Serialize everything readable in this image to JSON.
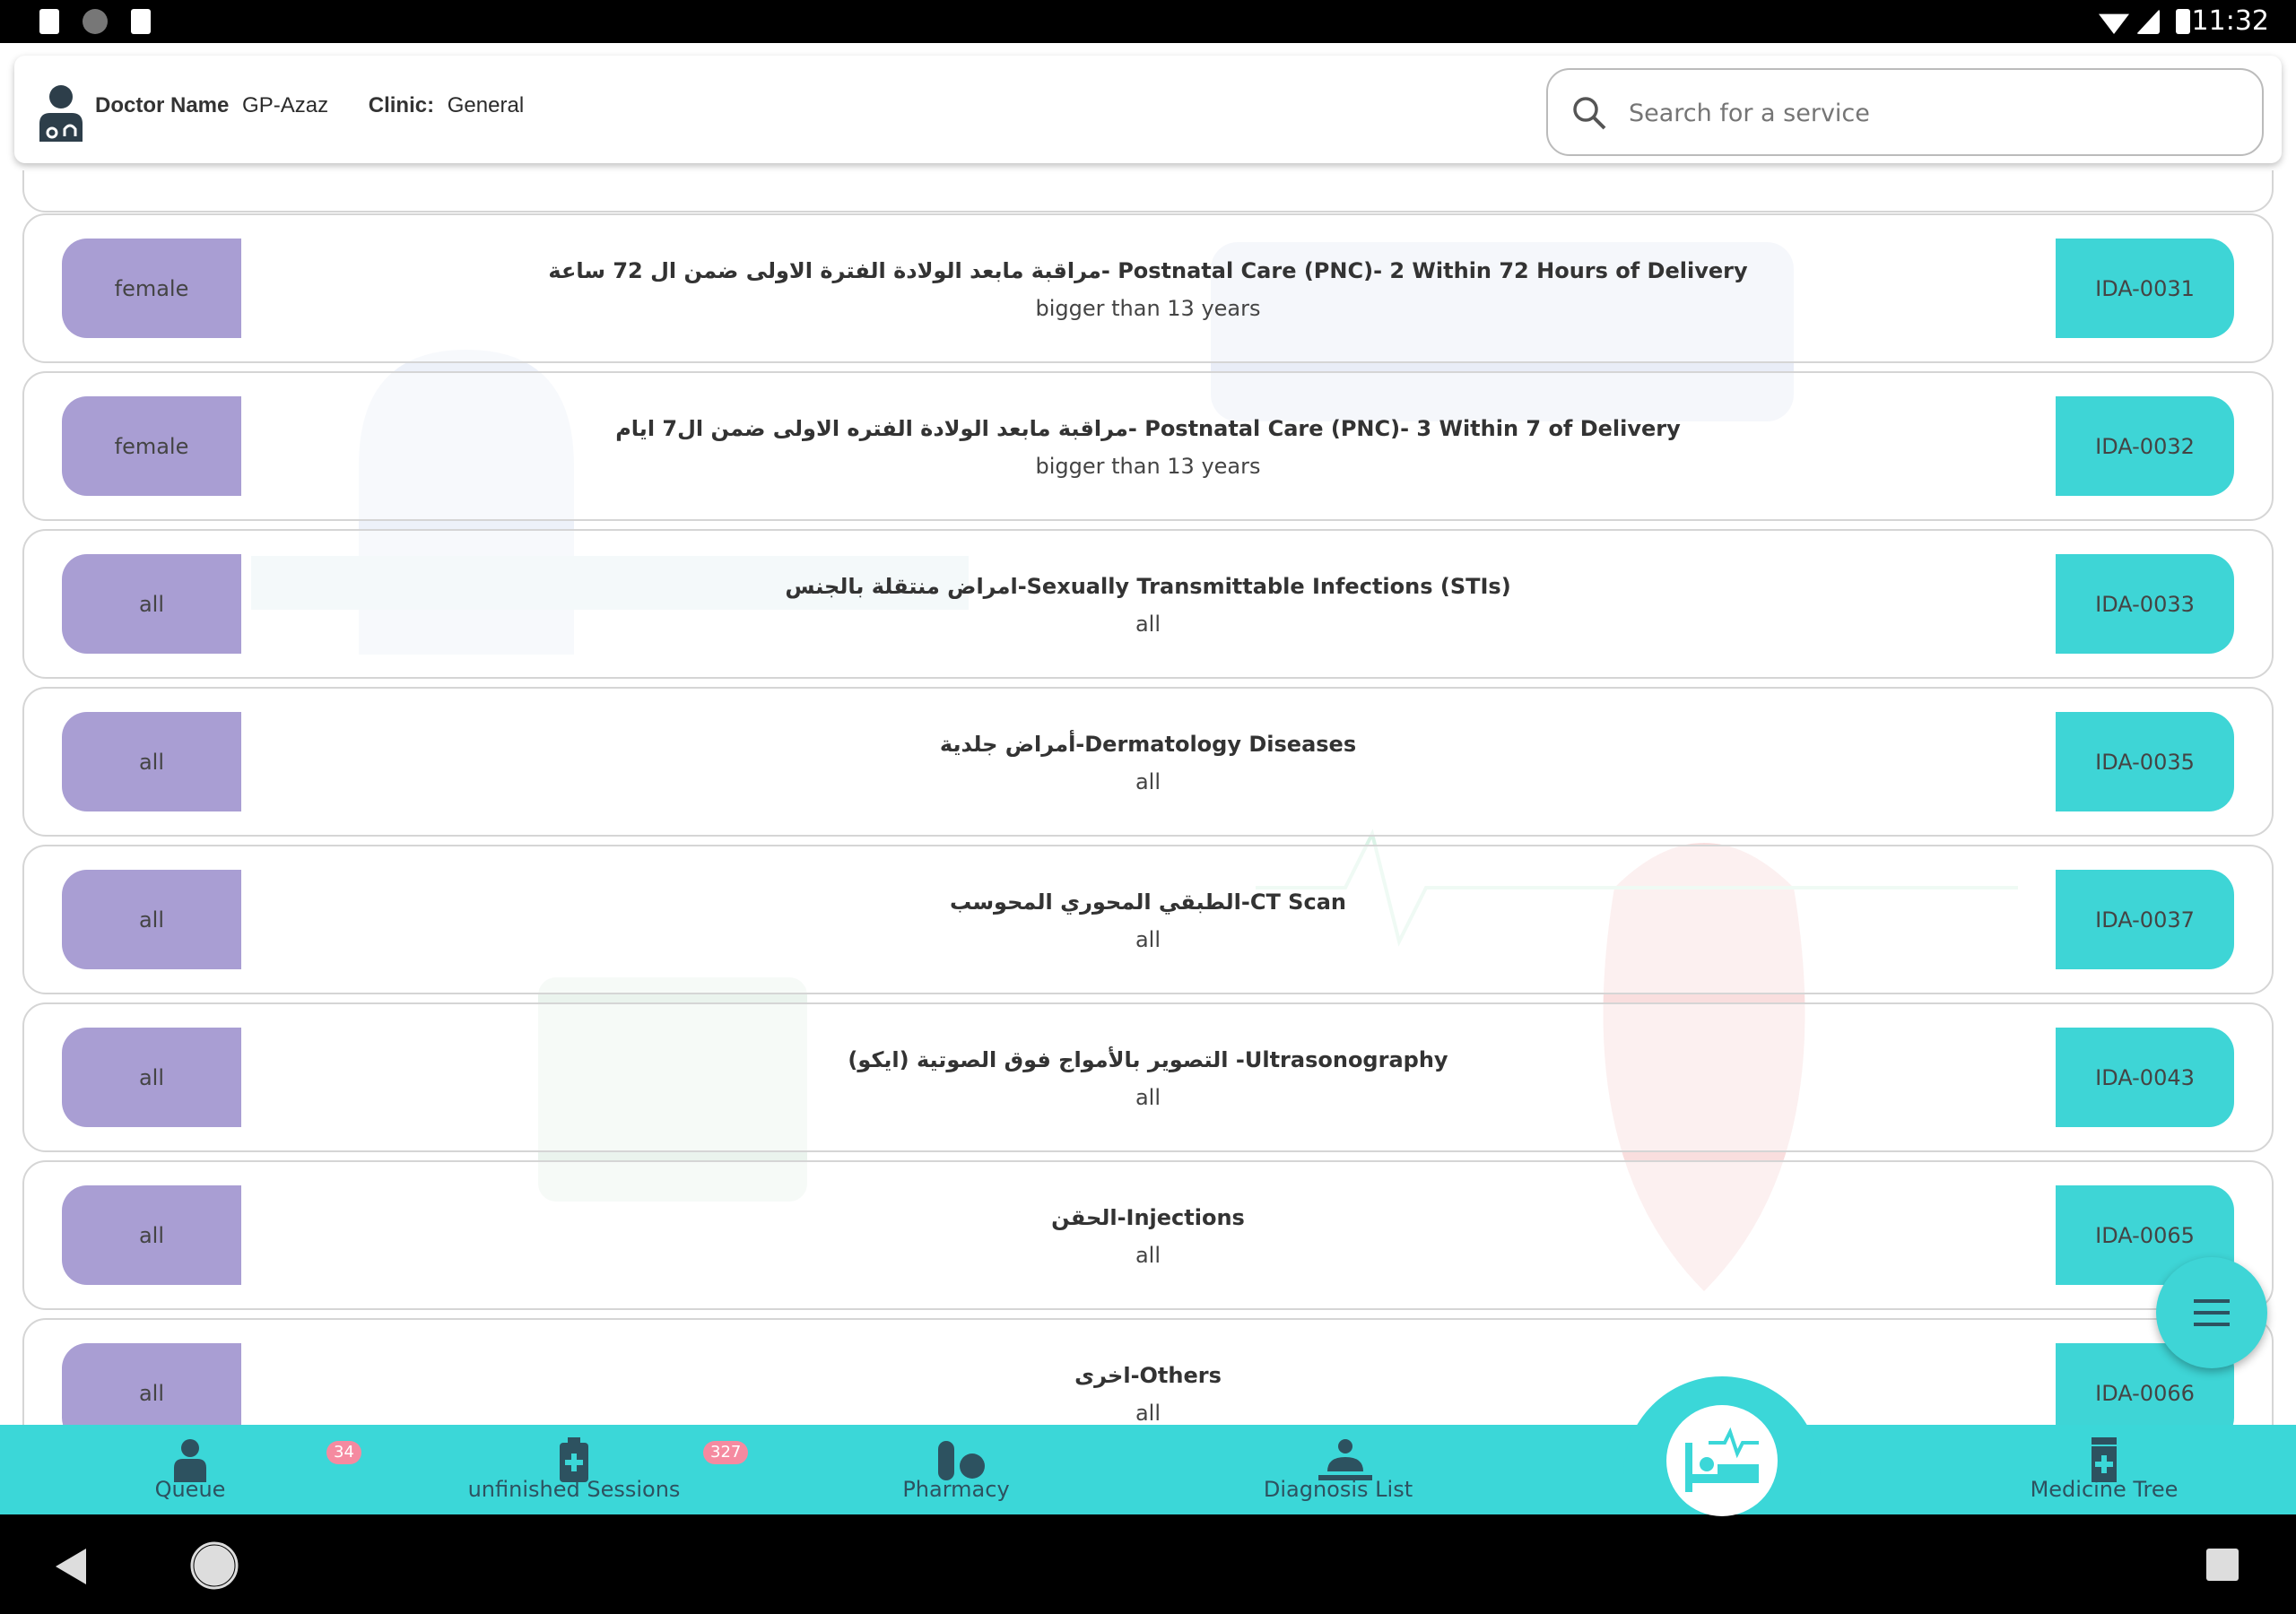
{
  "status_bar": {
    "time": "11:32"
  },
  "header": {
    "doctor_label": "Doctor Name",
    "doctor_value": "GP-Azaz",
    "clinic_label": "Clinic:",
    "clinic_value": "General",
    "search_placeholder": "Search for a service"
  },
  "services": [
    {
      "gender": "female",
      "title": "مراقبة مابعد الولادة الفترة الاولى ضمن ال 72 ساعة- Postnatal Care (PNC)- 2 Within 72 Hours of Delivery",
      "age": "bigger than 13 years",
      "code": "IDA-0031"
    },
    {
      "gender": "female",
      "title": "مراقبة مابعد الولادة الفتره الاولى ضمن ال7 ايام- Postnatal Care (PNC)- 3 Within 7  of Delivery",
      "age": "bigger than 13 years",
      "code": "IDA-0032"
    },
    {
      "gender": "all",
      "title": "امراض منتقلة بالجنس-Sexually Transmittable Infections (STIs)",
      "age": "all",
      "code": "IDA-0033"
    },
    {
      "gender": "all",
      "title": "أمراض جلدية-Dermatology Diseases",
      "age": "all",
      "code": "IDA-0035"
    },
    {
      "gender": "all",
      "title": "الطبقي المحوري المحوسب-CT Scan",
      "age": "all",
      "code": "IDA-0037"
    },
    {
      "gender": "all",
      "title": "التصوير بالأمواج فوق الصوتية (ايكو)  -Ultrasonography",
      "age": "all",
      "code": "IDA-0043"
    },
    {
      "gender": "all",
      "title": "الحقن-Injections",
      "age": "all",
      "code": "IDA-0065"
    },
    {
      "gender": "all",
      "title": "اخرى-Others",
      "age": "all",
      "code": "IDA-0066"
    }
  ],
  "nav": {
    "queue": {
      "label": "Queue",
      "badge": "34"
    },
    "sessions": {
      "label": "unfinished Sessions",
      "badge": "327"
    },
    "pharmacy": {
      "label": "Pharmacy"
    },
    "diagnosis": {
      "label": "Diagnosis List"
    },
    "medicine": {
      "label": "Medicine Tree"
    }
  },
  "colors": {
    "accent": "#3bd7d8",
    "gender_pill": "#a99ed3",
    "badge": "#f58aa0",
    "icon": "#2d5260"
  }
}
